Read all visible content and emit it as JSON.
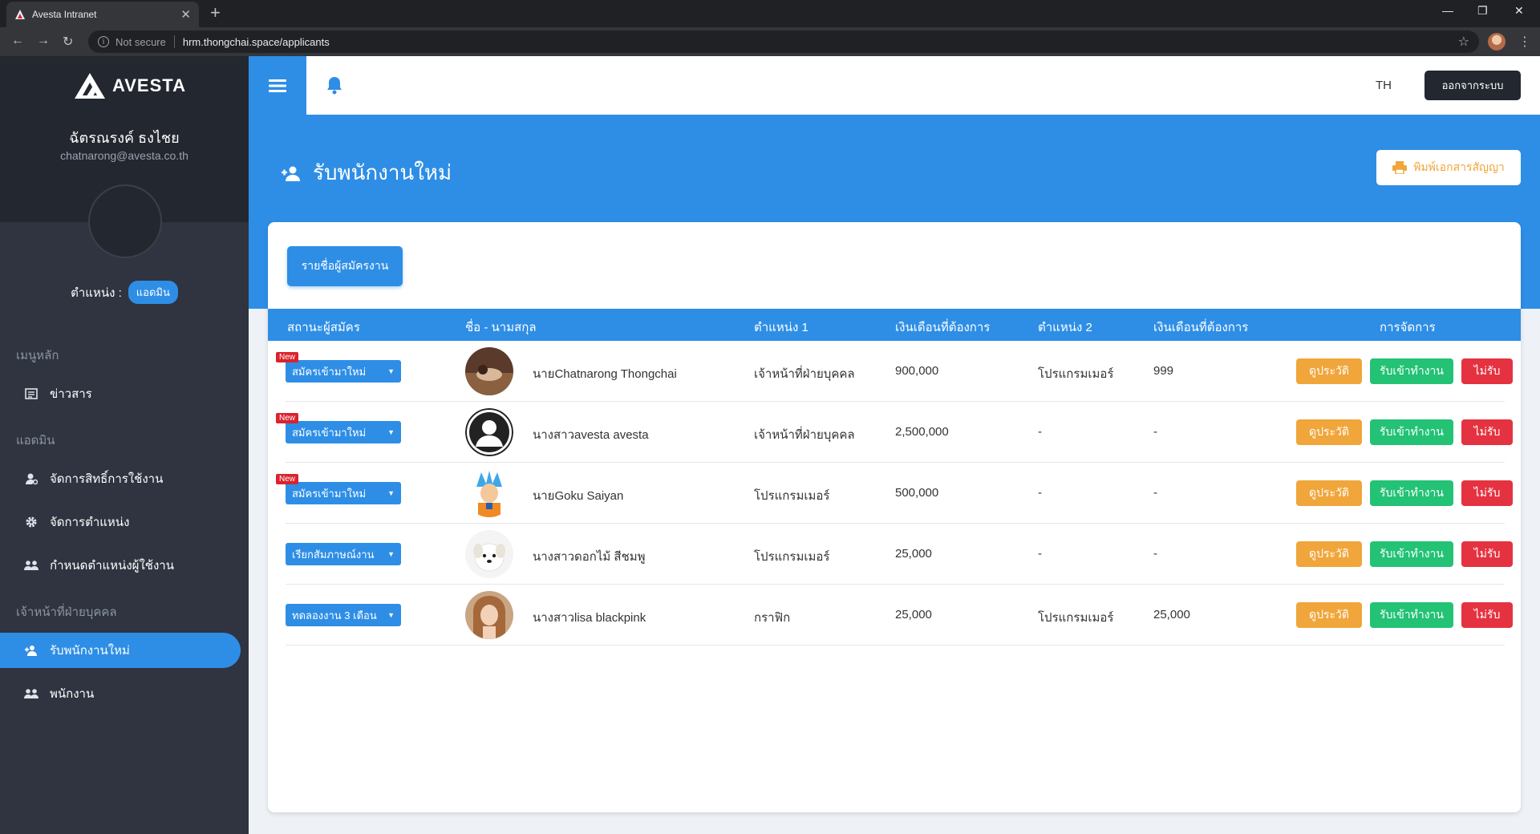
{
  "browser": {
    "tab_title": "Avesta Intranet",
    "security": "Not secure",
    "url": "hrm.thongchai.space/applicants"
  },
  "sidebar": {
    "brand": "AVESTA",
    "user_name": "ฉัตรณรงค์ ธงไชย",
    "user_email": "chatnarong@avesta.co.th",
    "role_label": "ตำแหน่ง :",
    "role_value": "แอดมิน",
    "sections": [
      {
        "title": "เมนูหลัก"
      },
      {
        "title": "แอดมิน"
      },
      {
        "title": "เจ้าหน้าที่ฝ่ายบุคคล"
      }
    ],
    "items": [
      {
        "label": "ข่าวสาร",
        "icon": "news-icon"
      },
      {
        "label": "จัดการสิทธิ์การใช้งาน",
        "icon": "user-permission-icon"
      },
      {
        "label": "จัดการตำแหน่ง",
        "icon": "gear-icon"
      },
      {
        "label": "กำหนดตำแหน่งผู้ใช้งาน",
        "icon": "users-icon"
      },
      {
        "label": "รับพนักงานใหม่",
        "icon": "user-plus-icon",
        "active": true
      },
      {
        "label": "พนักงาน",
        "icon": "users-icon"
      }
    ]
  },
  "header": {
    "lang": "TH",
    "logout_label": "ออกจากระบบ"
  },
  "page": {
    "title": "รับพนักงานใหม่",
    "print_label": "พิมพ์เอกสารสัญญา",
    "list_button": "รายชื่อผู้สมัครงาน"
  },
  "table": {
    "headers": [
      "สถานะผู้สมัคร",
      "ชื่อ - นามสกุล",
      "ตำแหน่ง 1",
      "เงินเดือนที่ต้องการ",
      "ตำแหน่ง 2",
      "เงินเดือนที่ต้องการ",
      "การจัดการ"
    ],
    "new_badge": "New",
    "action_history": "ดูประวัติ",
    "action_hire": "รับเข้าทำงาน",
    "action_reject": "ไม่รับ",
    "rows": [
      {
        "status": "สมัครเข้ามาใหม่",
        "is_new": true,
        "name": "นายChatnarong Thongchai",
        "position1": "เจ้าหน้าที่ฝ่ายบุคคล",
        "salary1": "900,000",
        "position2": "โปรแกรมเมอร์",
        "salary2": "999"
      },
      {
        "status": "สมัครเข้ามาใหม่",
        "is_new": true,
        "name": "นางสาวavesta avesta",
        "position1": "เจ้าหน้าที่ฝ่ายบุคคล",
        "salary1": "2,500,000",
        "position2": "-",
        "salary2": "-"
      },
      {
        "status": "สมัครเข้ามาใหม่",
        "is_new": true,
        "name": "นายGoku Saiyan",
        "position1": "โปรแกรมเมอร์",
        "salary1": "500,000",
        "position2": "-",
        "salary2": "-"
      },
      {
        "status": "เรียกสัมภาษณ์งาน",
        "is_new": false,
        "name": "นางสาวดอกไม้ สีชมพู",
        "position1": "โปรแกรมเมอร์",
        "salary1": "25,000",
        "position2": "-",
        "salary2": "-"
      },
      {
        "status": "ทดลองงาน 3 เดือน",
        "is_new": false,
        "name": "นางสาวlisa blackpink",
        "position1": "กราฟิก",
        "salary1": "25,000",
        "position2": "โปรแกรมเมอร์",
        "salary2": "25,000"
      }
    ]
  },
  "colors": {
    "primary": "#2e8ee6",
    "sidebar": "#2f3440",
    "sidebar_head": "#23272f",
    "history": "#f0a63a",
    "hire": "#23c275",
    "reject": "#e53240",
    "new_badge": "#d9232d"
  }
}
